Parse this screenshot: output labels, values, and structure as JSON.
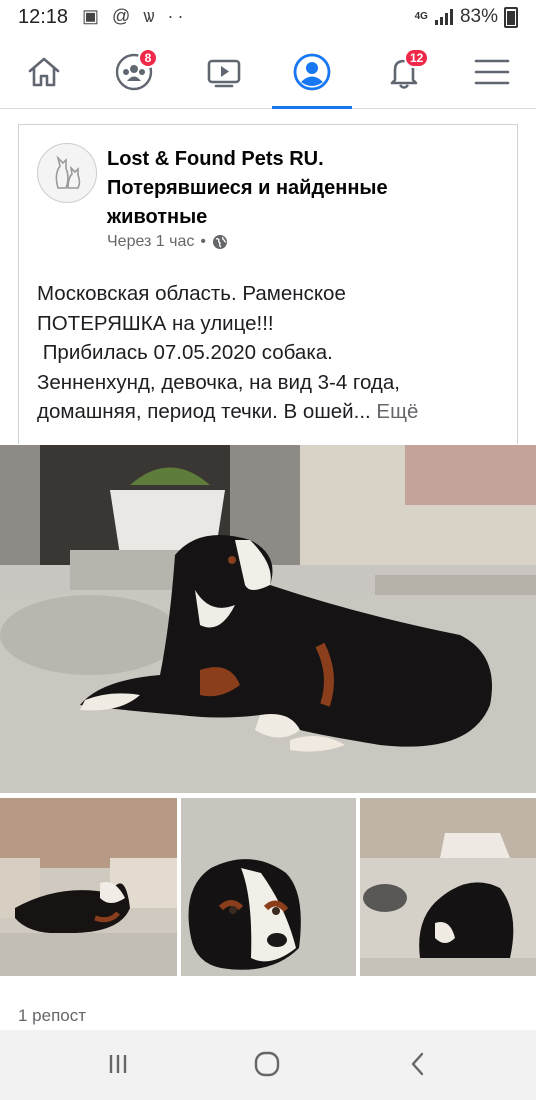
{
  "status_bar": {
    "time": "12:18",
    "left_icons": "▣ @ ѡ ··",
    "network": "4G",
    "battery": "83%"
  },
  "nav": {
    "items": [
      {
        "name": "home",
        "icon": "home-icon"
      },
      {
        "name": "groups",
        "icon": "groups-icon",
        "badge": "8"
      },
      {
        "name": "watch",
        "icon": "watch-icon"
      },
      {
        "name": "profile",
        "icon": "profile-icon",
        "active": true
      },
      {
        "name": "notifications",
        "icon": "bell-icon",
        "badge": "12"
      },
      {
        "name": "menu",
        "icon": "menu-icon"
      }
    ],
    "accent": "#1877f2",
    "badge_color": "#f02849"
  },
  "post": {
    "page_name": "Lost & Found Pets RU. Потерявшиеся и найденные животные",
    "time": "Через 1 час",
    "separator": "•",
    "text_lines": [
      "Московская область. Раменское",
      "ПОТЕРЯШКА на улице!!!",
      " Прибилась 07.05.2020 собака.",
      "Зенненхунд, девочка, на вид 3-4 года,",
      "домашняя, период течки. В ошей..."
    ],
    "see_more": "Ещё",
    "reposts": "1 репост"
  },
  "system_nav": {
    "recents": "recents-icon",
    "home": "home-circle-icon",
    "back": "back-icon"
  }
}
